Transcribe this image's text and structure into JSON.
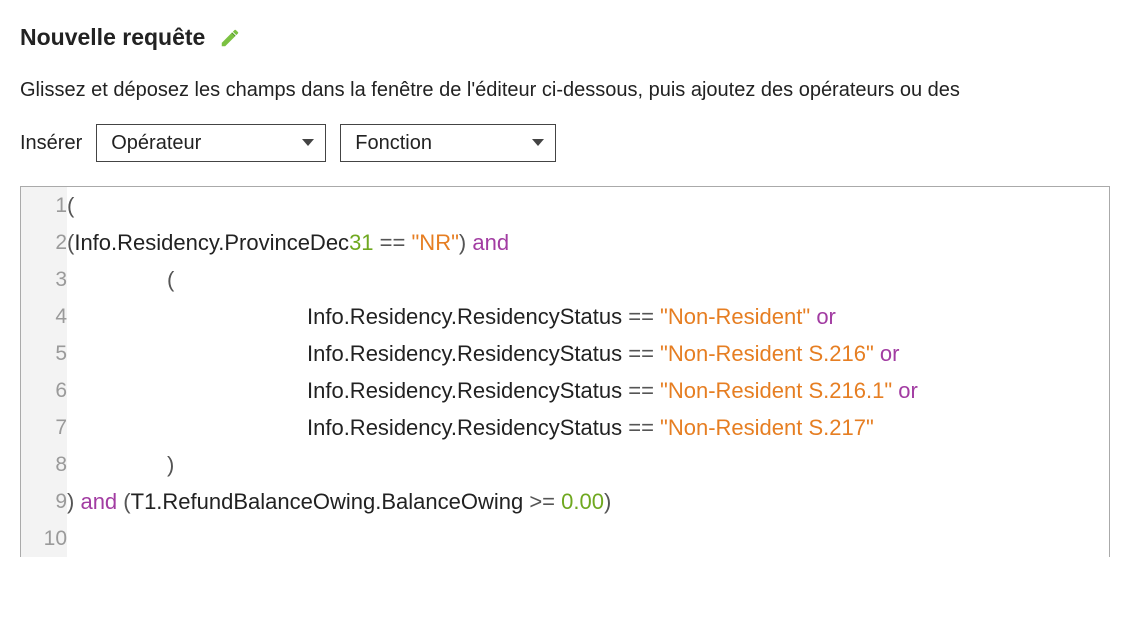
{
  "header": {
    "title": "Nouvelle requête",
    "edit_icon_name": "edit-pencil"
  },
  "instructions": "Glissez et déposez les champs dans la fenêtre de l'éditeur ci-dessous, puis ajoutez des opérateurs ou des",
  "insert": {
    "label": "Insérer",
    "operator_label": "Opérateur",
    "function_label": "Fonction"
  },
  "code": {
    "lines": [
      {
        "n": "1",
        "tokens": [
          {
            "t": "(",
            "c": "pn"
          }
        ]
      },
      {
        "n": "2",
        "tokens": [
          {
            "t": "(",
            "c": "pn"
          },
          {
            "t": "Info.Residency.ProvinceDec",
            "c": "var"
          },
          {
            "t": "31",
            "c": "num"
          },
          {
            "t": " ",
            "c": "sp"
          },
          {
            "t": "==",
            "c": "pn"
          },
          {
            "t": " ",
            "c": "sp"
          },
          {
            "t": "\"NR\"",
            "c": "str"
          },
          {
            "t": ")",
            "c": "pn"
          },
          {
            "t": " ",
            "c": "sp"
          },
          {
            "t": "and",
            "c": "kw"
          }
        ]
      },
      {
        "n": "3",
        "indent": 100,
        "tokens": [
          {
            "t": "(",
            "c": "pn"
          }
        ]
      },
      {
        "n": "4",
        "indent": 240,
        "tokens": [
          {
            "t": "Info.Residency.ResidencyStatus",
            "c": "var"
          },
          {
            "t": " ",
            "c": "sp"
          },
          {
            "t": "==",
            "c": "pn"
          },
          {
            "t": " ",
            "c": "sp"
          },
          {
            "t": "\"Non-Resident\"",
            "c": "str"
          },
          {
            "t": " ",
            "c": "sp"
          },
          {
            "t": "or",
            "c": "kw"
          }
        ]
      },
      {
        "n": "5",
        "indent": 240,
        "tokens": [
          {
            "t": "Info.Residency.ResidencyStatus",
            "c": "var"
          },
          {
            "t": " ",
            "c": "sp"
          },
          {
            "t": "==",
            "c": "pn"
          },
          {
            "t": " ",
            "c": "sp"
          },
          {
            "t": "\"Non-Resident S.216\"",
            "c": "str"
          },
          {
            "t": " ",
            "c": "sp"
          },
          {
            "t": "or",
            "c": "kw"
          }
        ]
      },
      {
        "n": "6",
        "indent": 240,
        "tokens": [
          {
            "t": "Info.Residency.ResidencyStatus",
            "c": "var"
          },
          {
            "t": " ",
            "c": "sp"
          },
          {
            "t": "==",
            "c": "pn"
          },
          {
            "t": " ",
            "c": "sp"
          },
          {
            "t": "\"Non-Resident S.216.1\"",
            "c": "str"
          },
          {
            "t": " ",
            "c": "sp"
          },
          {
            "t": "or",
            "c": "kw"
          }
        ]
      },
      {
        "n": "7",
        "indent": 240,
        "tokens": [
          {
            "t": "Info.Residency.ResidencyStatus",
            "c": "var"
          },
          {
            "t": " ",
            "c": "sp"
          },
          {
            "t": "==",
            "c": "pn"
          },
          {
            "t": " ",
            "c": "sp"
          },
          {
            "t": "\"Non-Resident S.217\"",
            "c": "str"
          }
        ]
      },
      {
        "n": "8",
        "indent": 100,
        "tokens": [
          {
            "t": ")",
            "c": "pn"
          }
        ]
      },
      {
        "n": "9",
        "tokens": [
          {
            "t": ")",
            "c": "pn"
          },
          {
            "t": " ",
            "c": "sp"
          },
          {
            "t": "and",
            "c": "kw"
          },
          {
            "t": " ",
            "c": "sp"
          },
          {
            "t": "(",
            "c": "pn"
          },
          {
            "t": "T1.RefundBalanceOwing.BalanceOwing",
            "c": "var"
          },
          {
            "t": " ",
            "c": "sp"
          },
          {
            "t": ">=",
            "c": "pn"
          },
          {
            "t": " ",
            "c": "sp"
          },
          {
            "t": "0.00",
            "c": "num"
          },
          {
            "t": ")",
            "c": "pn"
          }
        ]
      },
      {
        "n": "10",
        "tokens": []
      }
    ]
  }
}
